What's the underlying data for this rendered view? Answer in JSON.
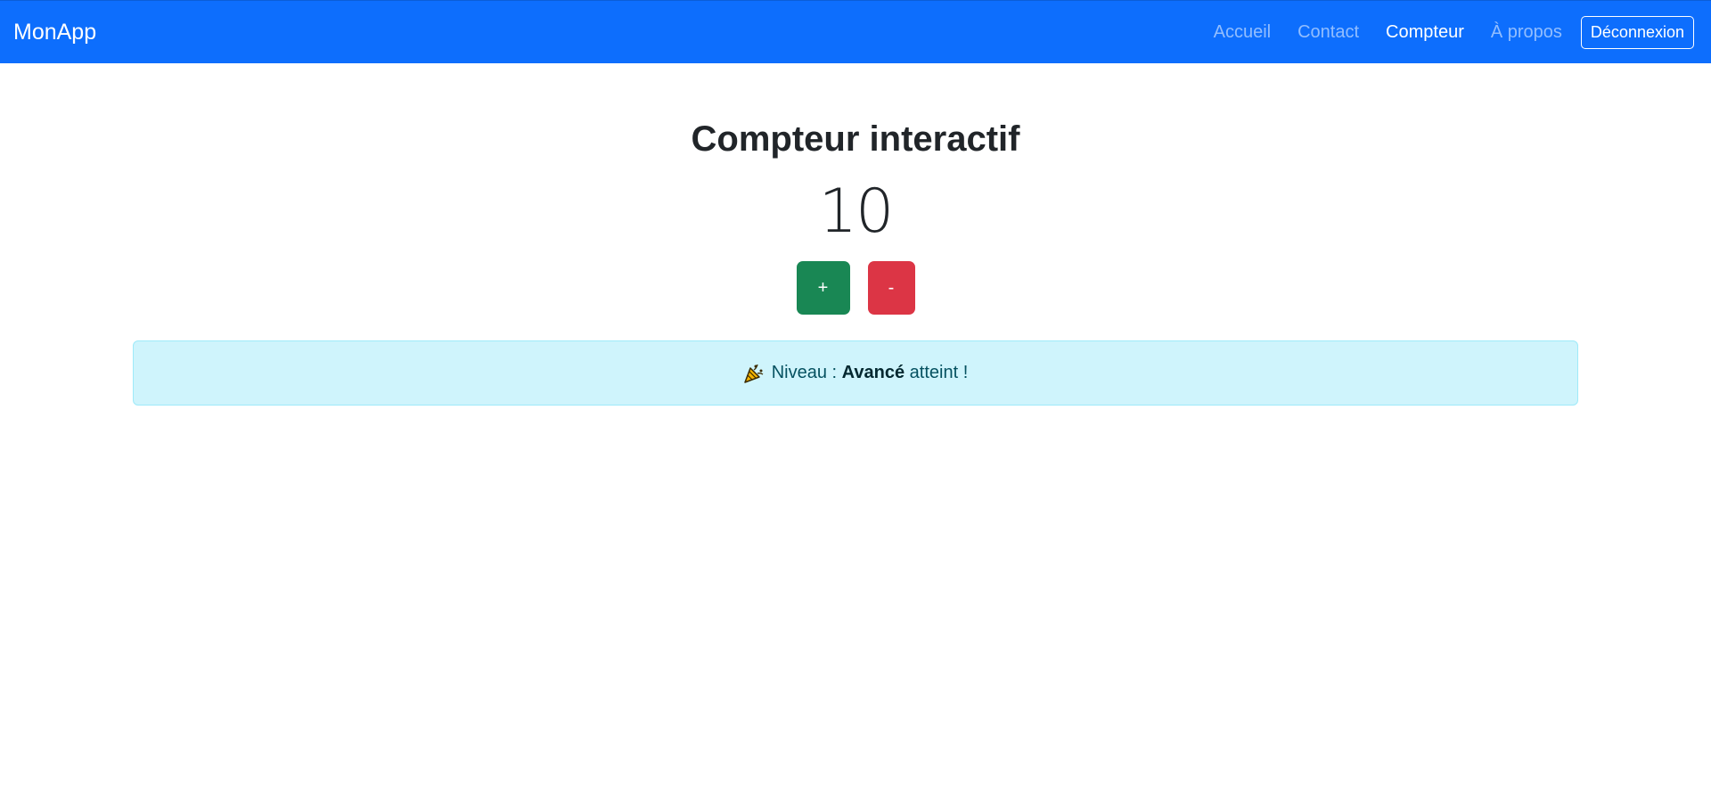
{
  "navbar": {
    "brand": "MonApp",
    "links": [
      {
        "label": "Accueil",
        "active": false
      },
      {
        "label": "Contact",
        "active": false
      },
      {
        "label": "Compteur",
        "active": true
      },
      {
        "label": "À propos",
        "active": false
      }
    ],
    "logout_label": "Déconnexion",
    "background_color": "#0d6efd"
  },
  "main": {
    "title": "Compteur interactif",
    "counter_value": "10",
    "increment_label": "+",
    "decrement_label": "-",
    "increment_color": "#198754",
    "decrement_color": "#dc3545"
  },
  "alert": {
    "icon": "party-popper-icon",
    "prefix": "Niveau : ",
    "level": "Avancé",
    "suffix": " atteint !",
    "background_color": "#cff4fc"
  }
}
